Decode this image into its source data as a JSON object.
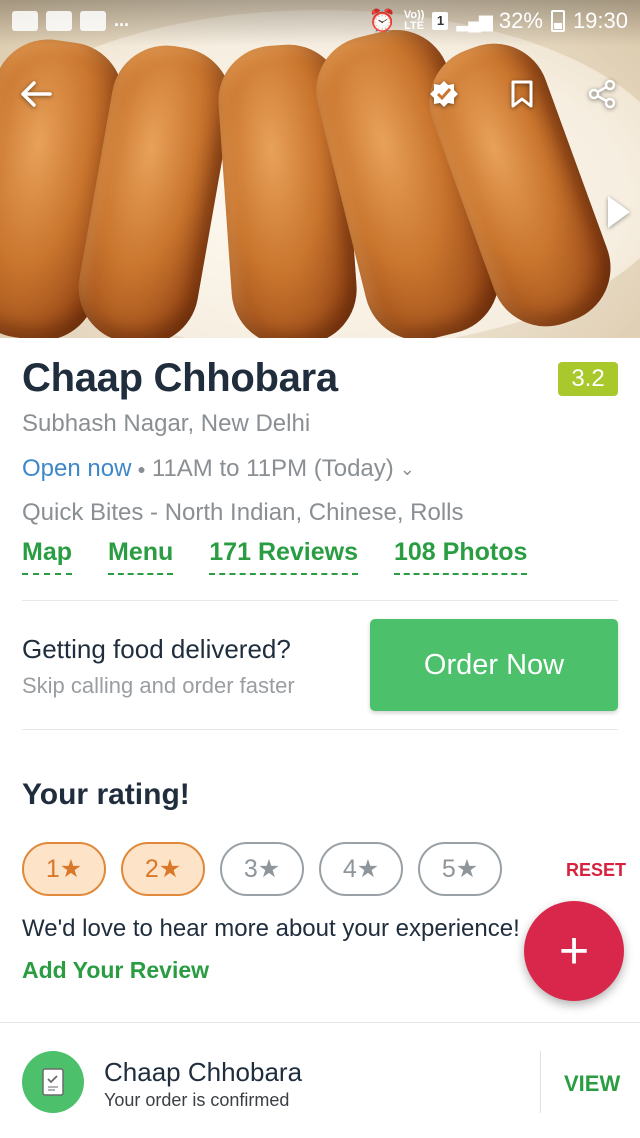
{
  "status_bar": {
    "battery": "32%",
    "time": "19:30",
    "dots": "...",
    "volte": "Vo))",
    "lte": "LTE",
    "sim": "1"
  },
  "restaurant": {
    "name": "Chaap Chhobara",
    "rating": "3.2",
    "locality": "Subhash Nagar, New Delhi",
    "open_status": "Open now",
    "hours": "11AM to 11PM (Today)",
    "cuisines": "Quick Bites - North Indian, Chinese, Rolls"
  },
  "links": {
    "map": "Map",
    "menu": "Menu",
    "reviews": "171 Reviews",
    "photos": "108 Photos"
  },
  "delivery": {
    "title": "Getting food delivered?",
    "subtitle": "Skip calling and order faster",
    "button": "Order Now"
  },
  "your_rating": {
    "title": "Your rating!",
    "options": [
      "1★",
      "2★",
      "3★",
      "4★",
      "5★"
    ],
    "selected": 2,
    "reset": "RESET",
    "prompt": "We'd love to hear more about your experience!",
    "add_review": "Add Your Review"
  },
  "fab": {
    "symbol": "+"
  },
  "order_bar": {
    "name": "Chaap Chhobara",
    "status": "Your order is confirmed",
    "action": "VIEW"
  },
  "colors": {
    "green": "#2a9d42",
    "order_button": "#4cc06a",
    "rating_badge": "#a8c82b",
    "fab": "#d8274a",
    "link_blue": "#3e88c9"
  }
}
